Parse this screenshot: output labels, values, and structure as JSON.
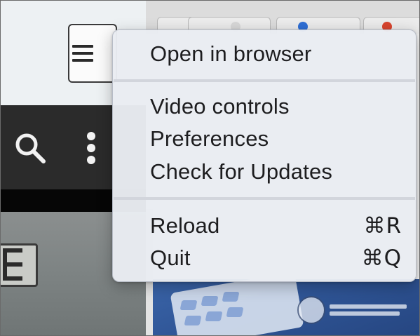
{
  "app": {
    "menu_button_icon": "hamburger-menu-icon",
    "toolbar_icons": [
      "search-icon",
      "more-vertical-icon"
    ]
  },
  "browser": {
    "tab_count": 4,
    "tab_favicon_colors": [
      "#d8d8d8",
      "#d8d8d8",
      "#2f6fd6",
      "#d9442e"
    ]
  },
  "context_menu": {
    "groups": [
      {
        "items": [
          {
            "label": "Open in browser",
            "shortcut": ""
          }
        ]
      },
      {
        "items": [
          {
            "label": "Video controls",
            "shortcut": ""
          },
          {
            "label": "Preferences",
            "shortcut": ""
          },
          {
            "label": "Check for Updates",
            "shortcut": ""
          }
        ]
      },
      {
        "items": [
          {
            "label": "Reload",
            "shortcut": "⌘R"
          },
          {
            "label": "Quit",
            "shortcut": "⌘Q"
          }
        ]
      }
    ]
  },
  "watermark": {
    "icon": "mascot-logo-icon"
  },
  "colors": {
    "menu_background": "#e9ecf2",
    "dark_toolbar": "#2b2b2b",
    "content_blue": "#2f5596"
  }
}
